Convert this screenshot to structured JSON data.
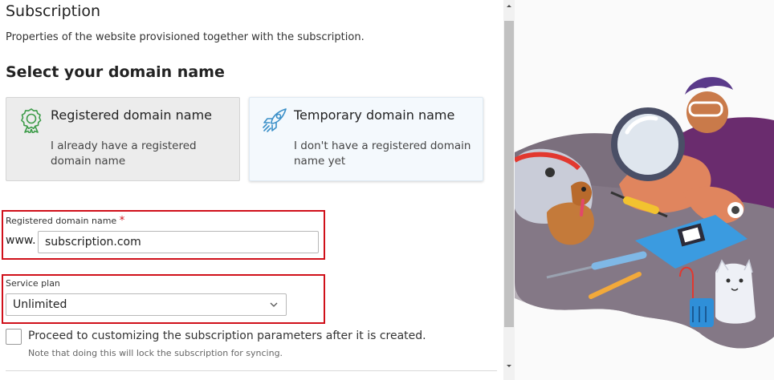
{
  "header": {
    "title": "Subscription",
    "subtitle": "Properties of the website provisioned together with the subscription."
  },
  "domain_section": {
    "title": "Select your domain name",
    "cards": [
      {
        "title": "Registered domain name",
        "description": "I already have a registered domain name",
        "icon": "award-ribbon-icon",
        "selected": true
      },
      {
        "title": "Temporary domain name",
        "description": "I don't have a registered domain name yet",
        "icon": "rocket-icon",
        "selected": false
      }
    ]
  },
  "domain_field": {
    "label": "Registered domain name",
    "required_mark": "*",
    "prefix": "www.",
    "value": "subscription.com"
  },
  "plan_field": {
    "label": "Service plan",
    "value": "Unlimited"
  },
  "customize": {
    "label": "Proceed to customizing the subscription parameters after it is created.",
    "note": "Note that doing this will lock the subscription for syncing.",
    "checked": false
  },
  "colors": {
    "highlight_border": "#d0101a",
    "icon_green": "#3e9c4a",
    "icon_blue": "#3a8fc8",
    "required": "#d0101a"
  }
}
